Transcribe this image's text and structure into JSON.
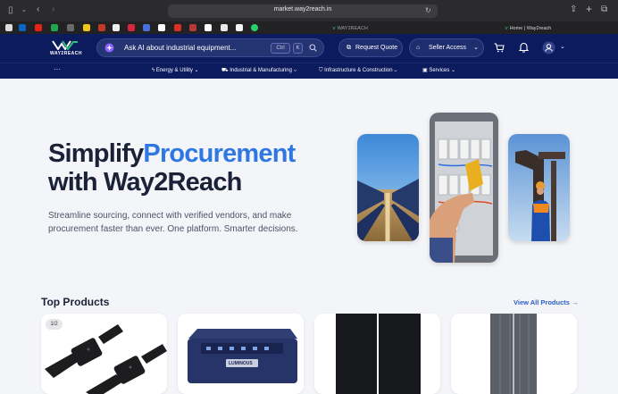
{
  "browser": {
    "url": "market.way2reach.in",
    "tab_1": "WAY2REACH",
    "tab_2": "Home | Way2reach"
  },
  "header": {
    "logo_text": "WAY2REACH",
    "ai_placeholder": "Ask AI about industrial equipment...",
    "kbd_1": "Ctrl",
    "kbd_2": "K",
    "request_quote": "Request Quote",
    "seller_access": "Seller Access"
  },
  "subnav": {
    "items": [
      {
        "label": "Energy & Utility"
      },
      {
        "label": "Industrial & Manufacturing"
      },
      {
        "label": "Infrastructure & Construction"
      },
      {
        "label": "Services"
      }
    ]
  },
  "hero": {
    "title_part_1": "Simplify",
    "title_accent": "Procurement",
    "title_line_2": "with Way2Reach",
    "description": "Streamline sourcing, connect with verified vendors, and make procurement faster than ever. One platform. Smarter decisions."
  },
  "products": {
    "title": "Top Products",
    "view_all": "View All Products →",
    "badge": "1/2",
    "inverter_brand": "LUMINOUS"
  },
  "colors": {
    "navy": "#0c1a5e",
    "accent_blue": "#2f78e3",
    "heading": "#1b2238"
  }
}
